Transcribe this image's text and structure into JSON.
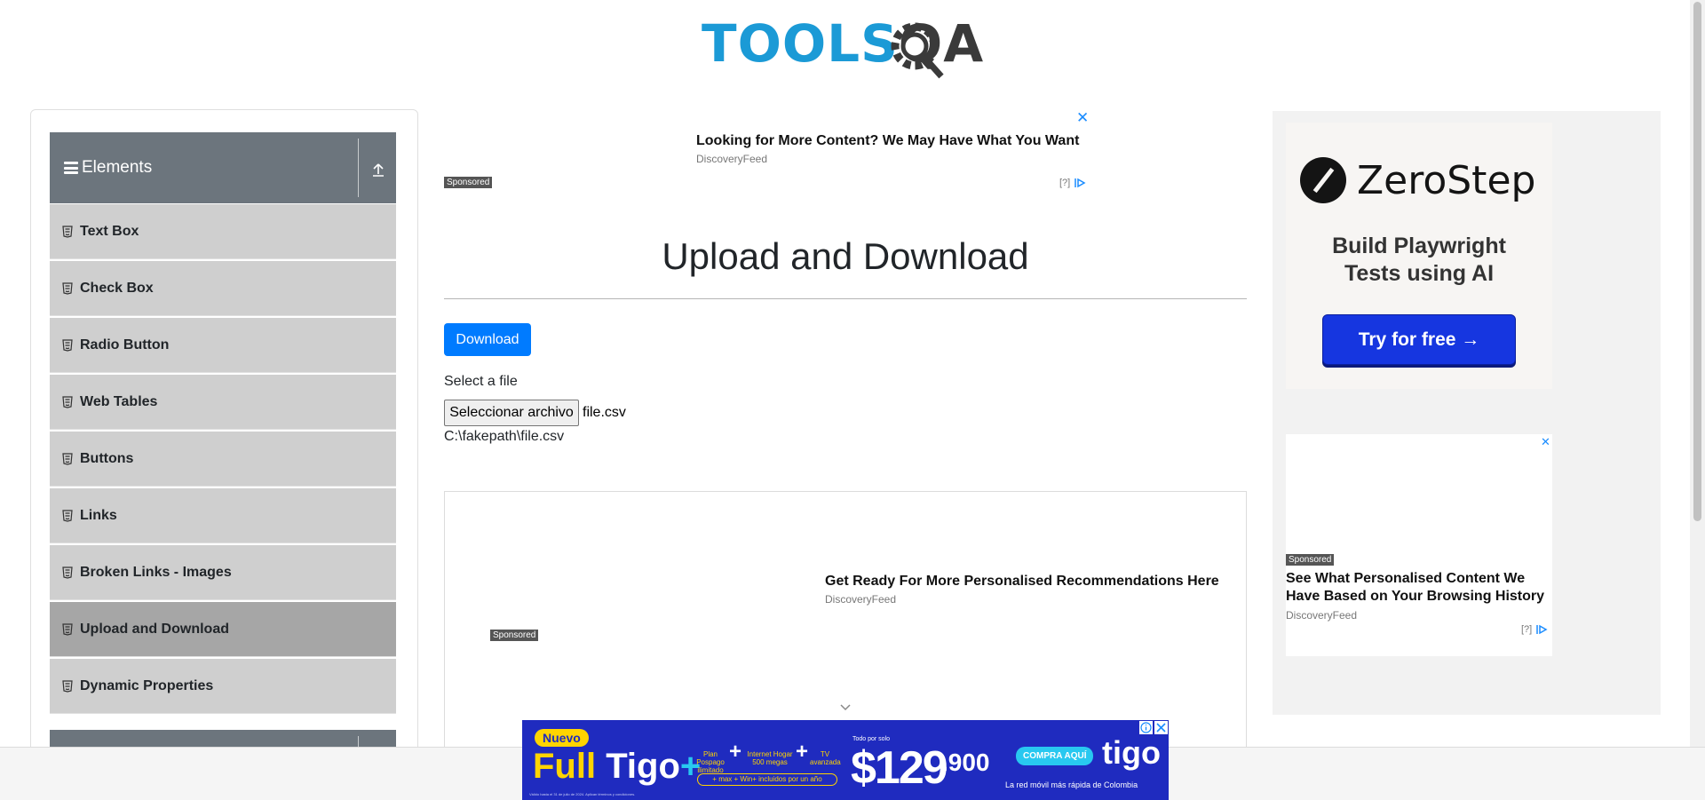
{
  "header": {
    "logo_part1": "TOOLS",
    "logo_part2": "QA"
  },
  "sidebar": {
    "group_title": "Elements",
    "items": [
      {
        "label": "Text Box"
      },
      {
        "label": "Check Box"
      },
      {
        "label": "Radio Button"
      },
      {
        "label": "Web Tables"
      },
      {
        "label": "Buttons"
      },
      {
        "label": "Links"
      },
      {
        "label": "Broken Links - Images"
      },
      {
        "label": "Upload and Download",
        "active": true
      },
      {
        "label": "Dynamic Properties"
      }
    ]
  },
  "ad_top": {
    "headline": "Looking for More Content? We May Have What You Want",
    "source": "DiscoveryFeed",
    "sponsored": "Sponsored",
    "adchoice": "[?]",
    "close": "✕"
  },
  "main": {
    "title": "Upload and Download",
    "download_label": "Download",
    "select_label": "Select a file",
    "file_button_label": "Seleccionar archivo",
    "file_name": "file.csv",
    "uploaded_path": "C:\\fakepath\\file.csv"
  },
  "ad_mid": {
    "headline": "Get Ready For More Personalised Recommendations Here",
    "source": "DiscoveryFeed",
    "sponsored": "Sponsored"
  },
  "right_ad": {
    "brand": "ZeroStep",
    "tagline_line1": "Build Playwright",
    "tagline_line2": "Tests using AI",
    "cta": "Try for free →"
  },
  "right_ad2": {
    "close": "✕",
    "sponsored": "Sponsored",
    "headline": "See What Personalised Content We Have Based on Your Browsing History",
    "source": "DiscoveryFeed",
    "adchoice": "[?]"
  },
  "bottom_ad": {
    "badge": "Nuevo",
    "title_part1": "Full ",
    "title_part2": "Tigo",
    "title_plus": "+",
    "feature1": "Plan Pospago ilimitado",
    "feature2": "Internet Hogar 500 megas",
    "feature3": "TV avanzada",
    "pill": "+ max + Win+ incluidos por un año",
    "price_prefix": "Todo por solo",
    "price": "$129",
    "price_cents": ".900",
    "cta": "COMPRA AQUÍ",
    "brand": "tigo",
    "slogan": "La red móvil más rápida de Colombia",
    "legal": "Válido hasta el 31 de julio de 2024. Aplican términos y condiciones."
  },
  "colors": {
    "logo_blue": "#1b9ad6",
    "sidebar_header": "#6c757d",
    "menu_item": "#cfcfcf",
    "menu_item_active": "#a6a6a6",
    "primary_button": "#007bff",
    "ad_link": "#1a8cff",
    "tigo_blue": "#1f2bbf",
    "tigo_yellow": "#ffd400",
    "zerostep_button": "#1636e0"
  }
}
